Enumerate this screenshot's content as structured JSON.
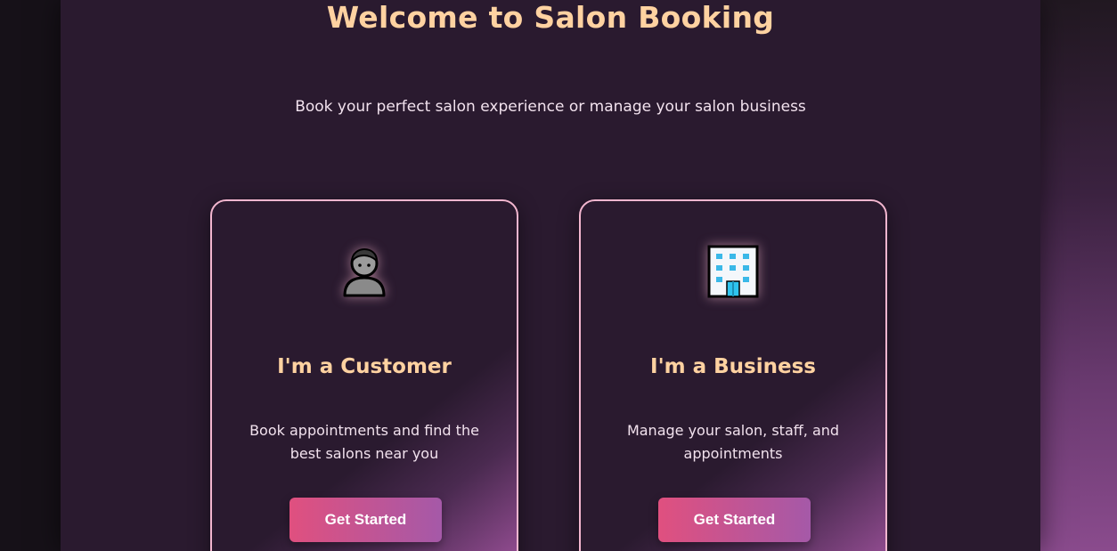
{
  "header": {
    "title": "Welcome to Salon Booking",
    "subtitle": "Book your perfect salon experience or manage your salon business"
  },
  "cards": [
    {
      "icon": "person-icon",
      "title": "I'm a Customer",
      "description": "Book appointments and find the best salons near you",
      "button_label": "Get Started"
    },
    {
      "icon": "office-building-icon",
      "title": "I'm a Business",
      "description": "Manage your salon, staff, and appointments",
      "button_label": "Get Started"
    }
  ],
  "colors": {
    "accent": "#ffd2a1",
    "card_border": "#f3b6cf",
    "button_start": "#e0507f",
    "button_end": "#a559a8",
    "panel_background": "#2a1a2f"
  }
}
